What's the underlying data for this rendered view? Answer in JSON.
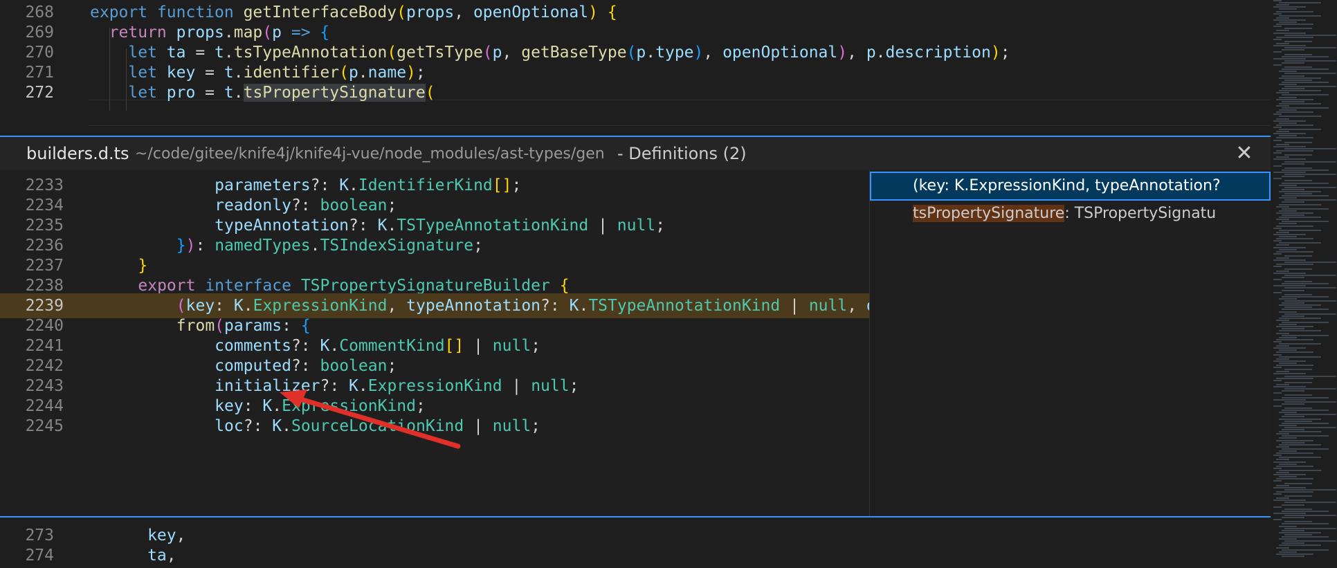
{
  "top_lines": [
    {
      "num": "268",
      "parts": [
        [
          "kwb",
          "export "
        ],
        [
          "kwb",
          "function "
        ],
        [
          "fn",
          "getInterfaceBody"
        ],
        [
          "p1",
          "("
        ],
        [
          "var",
          "props"
        ],
        [
          "op",
          ", "
        ],
        [
          "var",
          "openOptional"
        ],
        [
          "p1",
          ")"
        ],
        [
          "op",
          " "
        ],
        [
          "p1",
          "{"
        ]
      ]
    },
    {
      "num": "269",
      "parts": [
        [
          "kw",
          "  return "
        ],
        [
          "var",
          "props"
        ],
        [
          "op",
          "."
        ],
        [
          "fn",
          "map"
        ],
        [
          "p2",
          "("
        ],
        [
          "var",
          "p"
        ],
        [
          "op",
          " "
        ],
        [
          "kwb",
          "=>"
        ],
        [
          "op",
          " "
        ],
        [
          "p3",
          "{"
        ]
      ]
    },
    {
      "num": "270",
      "parts": [
        [
          "kwb",
          "    let "
        ],
        [
          "var",
          "ta"
        ],
        [
          "op",
          " = "
        ],
        [
          "var",
          "t"
        ],
        [
          "op",
          "."
        ],
        [
          "fn",
          "tsTypeAnnotation"
        ],
        [
          "p1",
          "("
        ],
        [
          "fn",
          "getTsType"
        ],
        [
          "p2",
          "("
        ],
        [
          "var",
          "p"
        ],
        [
          "op",
          ", "
        ],
        [
          "fn",
          "getBaseType"
        ],
        [
          "p3",
          "("
        ],
        [
          "var",
          "p"
        ],
        [
          "op",
          "."
        ],
        [
          "var",
          "type"
        ],
        [
          "p3",
          ")"
        ],
        [
          "op",
          ", "
        ],
        [
          "var",
          "openOptional"
        ],
        [
          "p2",
          ")"
        ],
        [
          "op",
          ", "
        ],
        [
          "var",
          "p"
        ],
        [
          "op",
          "."
        ],
        [
          "var",
          "description"
        ],
        [
          "p1",
          ")"
        ],
        [
          "op",
          ";"
        ]
      ]
    },
    {
      "num": "271",
      "parts": [
        [
          "kwb",
          "    let "
        ],
        [
          "var",
          "key"
        ],
        [
          "op",
          " = "
        ],
        [
          "var",
          "t"
        ],
        [
          "op",
          "."
        ],
        [
          "fn",
          "identifier"
        ],
        [
          "p1",
          "("
        ],
        [
          "var",
          "p"
        ],
        [
          "op",
          "."
        ],
        [
          "var",
          "name"
        ],
        [
          "p1",
          ")"
        ],
        [
          "op",
          ";"
        ]
      ]
    },
    {
      "num": "272",
      "parts": [
        [
          "kwb",
          "    let "
        ],
        [
          "var",
          "pro"
        ],
        [
          "op",
          " = "
        ],
        [
          "var",
          "t"
        ],
        [
          "op",
          "."
        ],
        [
          "fn hl-word",
          "tsPropertySignature"
        ],
        [
          "p1",
          "("
        ]
      ]
    }
  ],
  "peek": {
    "file": "builders.d.ts",
    "path": "~/code/gitee/knife4j/knife4j-vue/node_modules/ast-types/gen",
    "description": "- Definitions (2)",
    "lines": [
      {
        "num": "2233",
        "parts": [
          [
            "var",
            "            parameters"
          ],
          [
            "op",
            "?: "
          ],
          [
            "var",
            "K"
          ],
          [
            "op",
            "."
          ],
          [
            "ty",
            "IdentifierKind"
          ],
          [
            "p1",
            "[]"
          ],
          [
            "op",
            ";"
          ]
        ]
      },
      {
        "num": "2234",
        "parts": [
          [
            "var",
            "            readonly"
          ],
          [
            "op",
            "?: "
          ],
          [
            "ty",
            "boolean"
          ],
          [
            "op",
            ";"
          ]
        ]
      },
      {
        "num": "2235",
        "parts": [
          [
            "var",
            "            typeAnnotation"
          ],
          [
            "op",
            "?: "
          ],
          [
            "var",
            "K"
          ],
          [
            "op",
            "."
          ],
          [
            "ty",
            "TSTypeAnnotationKind"
          ],
          [
            "op",
            " | "
          ],
          [
            "ty",
            "null"
          ],
          [
            "op",
            ";"
          ]
        ]
      },
      {
        "num": "2236",
        "parts": [
          [
            "p3",
            "        }"
          ],
          [
            "p2",
            ")"
          ],
          [
            "op",
            ": "
          ],
          [
            "ty",
            "namedTypes"
          ],
          [
            "op",
            "."
          ],
          [
            "ty",
            "TSIndexSignature"
          ],
          [
            "op",
            ";"
          ]
        ]
      },
      {
        "num": "2237",
        "parts": [
          [
            "p1",
            "    }"
          ]
        ]
      },
      {
        "num": "2238",
        "parts": [
          [
            "kw",
            "    export "
          ],
          [
            "kwb",
            "interface "
          ],
          [
            "ty",
            "TSPropertySignatureBuilder"
          ],
          [
            "op",
            " "
          ],
          [
            "p1",
            "{"
          ]
        ]
      },
      {
        "num": "2239",
        "parts": [
          [
            "p2",
            "        ("
          ],
          [
            "var",
            "key"
          ],
          [
            "op",
            ": "
          ],
          [
            "var",
            "K"
          ],
          [
            "op",
            "."
          ],
          [
            "ty",
            "ExpressionKind"
          ],
          [
            "op",
            ", "
          ],
          [
            "var",
            "typeAnnotation"
          ],
          [
            "op",
            "?: "
          ],
          [
            "var",
            "K"
          ],
          [
            "op",
            "."
          ],
          [
            "ty",
            "TSTypeAnnotationKind"
          ],
          [
            "op",
            " | "
          ],
          [
            "ty",
            "null"
          ],
          [
            "op",
            ", "
          ],
          [
            "var",
            "opt"
          ]
        ]
      },
      {
        "num": "2240",
        "parts": [
          [
            "fn",
            "        from"
          ],
          [
            "p2",
            "("
          ],
          [
            "var",
            "params"
          ],
          [
            "op",
            ": "
          ],
          [
            "p3",
            "{"
          ]
        ]
      },
      {
        "num": "2241",
        "parts": [
          [
            "var",
            "            comments"
          ],
          [
            "op",
            "?: "
          ],
          [
            "var",
            "K"
          ],
          [
            "op",
            "."
          ],
          [
            "ty",
            "CommentKind"
          ],
          [
            "p1",
            "[]"
          ],
          [
            "op",
            " | "
          ],
          [
            "ty",
            "null"
          ],
          [
            "op",
            ";"
          ]
        ]
      },
      {
        "num": "2242",
        "parts": [
          [
            "var",
            "            computed"
          ],
          [
            "op",
            "?: "
          ],
          [
            "ty",
            "boolean"
          ],
          [
            "op",
            ";"
          ]
        ]
      },
      {
        "num": "2243",
        "parts": [
          [
            "var",
            "            initializer"
          ],
          [
            "op",
            "?: "
          ],
          [
            "var",
            "K"
          ],
          [
            "op",
            "."
          ],
          [
            "ty",
            "ExpressionKind"
          ],
          [
            "op",
            " | "
          ],
          [
            "ty",
            "null"
          ],
          [
            "op",
            ";"
          ]
        ]
      },
      {
        "num": "2244",
        "parts": [
          [
            "var",
            "            key"
          ],
          [
            "op",
            ": "
          ],
          [
            "var",
            "K"
          ],
          [
            "op",
            "."
          ],
          [
            "ty",
            "ExpressionKind"
          ],
          [
            "op",
            ";"
          ]
        ]
      },
      {
        "num": "2245",
        "parts": [
          [
            "var",
            "            loc"
          ],
          [
            "op",
            "?: "
          ],
          [
            "var",
            "K"
          ],
          [
            "op",
            "."
          ],
          [
            "ty",
            "SourceLocationKind"
          ],
          [
            "op",
            " | "
          ],
          [
            "ty",
            "null"
          ],
          [
            "op",
            ";"
          ]
        ]
      }
    ],
    "references": [
      {
        "text": "(key: K.ExpressionKind, typeAnnotation?",
        "match": "",
        "rest": ""
      },
      {
        "text": "",
        "match": "tsPropertySignature",
        "rest": ": TSPropertySignatu"
      }
    ]
  },
  "bottom_lines": [
    {
      "num": "273",
      "parts": [
        [
          "var",
          "      key"
        ],
        [
          "op",
          ","
        ]
      ]
    },
    {
      "num": "274",
      "parts": [
        [
          "var",
          "      ta"
        ],
        [
          "op",
          ","
        ]
      ]
    }
  ],
  "colors": {
    "accent": "#3794ff",
    "annotation_arrow": "#e0302a"
  }
}
